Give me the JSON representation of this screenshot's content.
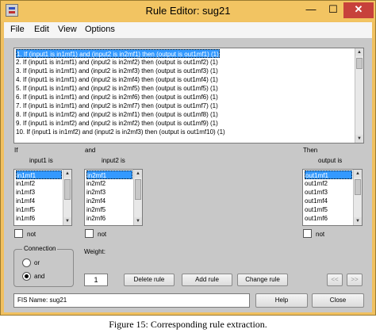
{
  "window": {
    "title": "Rule Editor: sug21",
    "minimize": "—",
    "maximize": "☐",
    "close": "✕"
  },
  "menu": [
    "File",
    "Edit",
    "View",
    "Options"
  ],
  "rules": [
    "1. If (input1 is in1mf1) and (input2 is in2mf1) then (output is out1mf1) (1)",
    "2. If (input1 is in1mf1) and (input2 is in2mf2) then (output is out1mf2) (1)",
    "3. If (input1 is in1mf1) and (input2 is in2mf3) then (output is out1mf3) (1)",
    "4. If (input1 is in1mf1) and (input2 is in2mf4) then (output is out1mf4) (1)",
    "5. If (input1 is in1mf1) and (input2 is in2mf5) then (output is out1mf5) (1)",
    "6. If (input1 is in1mf1) and (input2 is in2mf6) then (output is out1mf6) (1)",
    "7. If (input1 is in1mf1) and (input2 is in2mf7) then (output is out1mf7) (1)",
    "8. If (input1 is in1mf2) and (input2 is in2mf1) then (output is out1mf8) (1)",
    "9. If (input1 is in1mf2) and (input2 is in2mf2) then (output is out1mf9) (1)",
    "10. If (input1 is in1mf2) and (input2 is in2mf3) then (output is out1mf10) (1)"
  ],
  "labels": {
    "if": "If",
    "and": "and",
    "then": "Then",
    "input1": "input1 is",
    "input2": "input2 is",
    "output": "output is",
    "not": "not",
    "connection": "Connection",
    "or": "or",
    "and_radio": "and",
    "weight": "Weight:"
  },
  "input1_items": [
    "in1mf1",
    "in1mf2",
    "in1mf3",
    "in1mf4",
    "in1mf5",
    "in1mf6"
  ],
  "input2_items": [
    "in2mf1",
    "in2mf2",
    "in2mf3",
    "in2mf4",
    "in2mf5",
    "in2mf6"
  ],
  "output_items": [
    "out1mf1",
    "out1mf2",
    "out1mf3",
    "out1mf4",
    "out1mf5",
    "out1mf6"
  ],
  "weight_value": "1",
  "buttons": {
    "delete": "Delete rule",
    "add": "Add rule",
    "change": "Change rule",
    "prev": "<<",
    "next": ">>",
    "help": "Help",
    "close": "Close"
  },
  "status": "FIS Name: sug21",
  "caption": "Figure 15: Corresponding rule extraction.",
  "colors": {
    "title_bar": "#f2c462",
    "selection": "#3399ff",
    "close_button": "#c7413b",
    "panel": "#c8c8c8"
  }
}
